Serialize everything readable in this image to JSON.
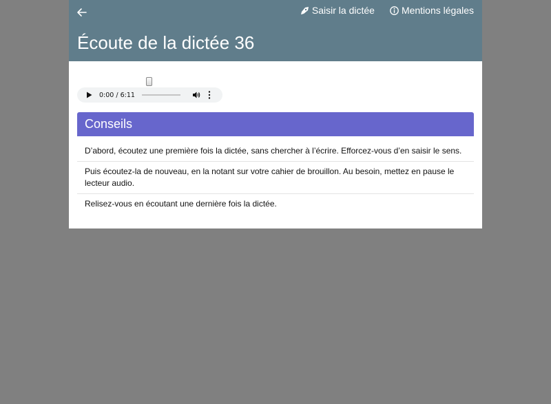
{
  "header": {
    "back_icon": "arrow-left-icon",
    "links": {
      "write": {
        "label": "Saisir la dictée",
        "icon": "pen-nib-icon"
      },
      "legal": {
        "label": "Mentions légales",
        "icon": "info-circle-icon"
      }
    },
    "title": "Écoute de la dictée 36",
    "color": "#607d8b"
  },
  "audio": {
    "time": "0:00 / 6:11",
    "progress": 0,
    "play_icon": "play-icon",
    "volume_icon": "volume-icon",
    "more_icon": "more-vertical-icon"
  },
  "tips": {
    "heading": "Conseils",
    "color": "#6766cc",
    "items": [
      "D’abord, écoutez une première fois la dictée, sans chercher à l’écrire. Efforcez-vous d’en saisir le sens.",
      "Puis écoutez-la de nouveau, en la notant sur votre cahier de brouillon. Au besoin, mettez en pause le lecteur audio.",
      "Relisez-vous en écoutant une dernière fois la dictée."
    ]
  }
}
